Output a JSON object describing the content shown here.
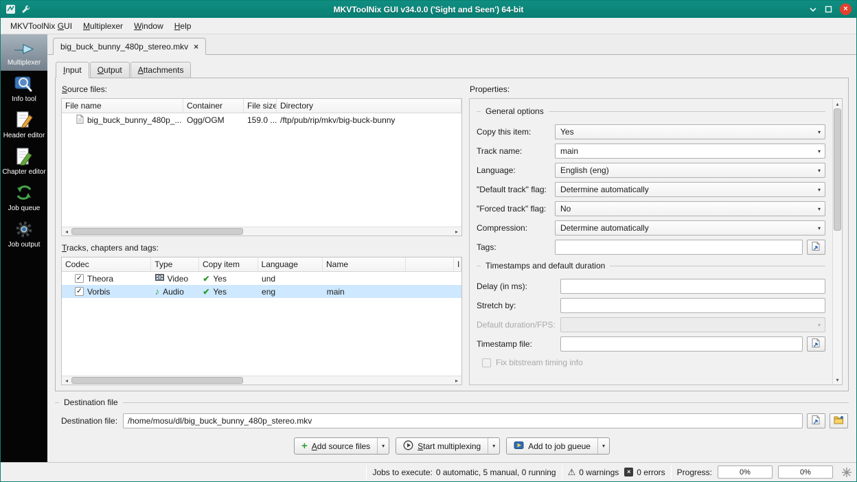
{
  "window": {
    "title": "MKVToolNix GUI v34.0.0 ('Sight and Seen') 64-bit"
  },
  "menubar": {
    "items": [
      {
        "label": "MKVToolNix GUI",
        "accel": 11
      },
      {
        "label": "Multiplexer",
        "accel": 0
      },
      {
        "label": "Window",
        "accel": 0
      },
      {
        "label": "Help",
        "accel": 0
      }
    ]
  },
  "sidebar": {
    "items": [
      {
        "label": "Multiplexer",
        "active": true
      },
      {
        "label": "Info tool",
        "active": false
      },
      {
        "label": "Header editor",
        "active": false
      },
      {
        "label": "Chapter editor",
        "active": false
      },
      {
        "label": "Job queue",
        "active": false
      },
      {
        "label": "Job output",
        "active": false
      }
    ]
  },
  "file_tab": {
    "label": "big_buck_bunny_480p_stereo.mkv"
  },
  "subtabs": [
    {
      "label": "Input",
      "accel": 0,
      "active": true
    },
    {
      "label": "Output",
      "accel": 0,
      "active": false
    },
    {
      "label": "Attachments",
      "accel": 0,
      "active": false
    }
  ],
  "source_files": {
    "label": {
      "label": "Source files:",
      "accel": 0
    },
    "columns": [
      "File name",
      "Container",
      "File size",
      "Directory"
    ],
    "rows": [
      {
        "file_name": "big_buck_bunny_480p_...",
        "container": "Ogg/OGM",
        "file_size": "159.0 ...",
        "directory": "/ftp/pub/rip/mkv/big-buck-bunny"
      }
    ]
  },
  "tracks": {
    "label": {
      "label": "Tracks, chapters and tags:",
      "accel": 0
    },
    "columns": [
      "Codec",
      "Type",
      "Copy item",
      "Language",
      "Name",
      "",
      "I"
    ],
    "rows": [
      {
        "codec": "Theora",
        "checked": true,
        "type": "Video",
        "copy_item": "Yes",
        "language": "und",
        "name": "",
        "selected": false
      },
      {
        "codec": "Vorbis",
        "checked": true,
        "type": "Audio",
        "copy_item": "Yes",
        "language": "eng",
        "name": "main",
        "selected": true
      }
    ]
  },
  "properties": {
    "label": "Properties:",
    "general": {
      "title": "General options",
      "copy_this_item": {
        "label": "Copy this item:",
        "value": "Yes"
      },
      "track_name": {
        "label": "Track name:",
        "value": "main"
      },
      "language": {
        "label": "Language:",
        "value": "English (eng)"
      },
      "default_track_flag": {
        "label": "\"Default track\" flag:",
        "value": "Determine automatically"
      },
      "forced_track_flag": {
        "label": "\"Forced track\" flag:",
        "value": "No"
      },
      "compression": {
        "label": "Compression:",
        "value": "Determine automatically"
      },
      "tags": {
        "label": "Tags:",
        "value": ""
      }
    },
    "timestamps": {
      "title": "Timestamps and default duration",
      "delay": {
        "label": "Delay (in ms):",
        "value": ""
      },
      "stretch_by": {
        "label": "Stretch by:",
        "value": ""
      },
      "default_duration": {
        "label": "Default duration/FPS:",
        "value": ""
      },
      "timestamp_file": {
        "label": "Timestamp file:",
        "value": ""
      },
      "fix_bitstream": {
        "label": "Fix bitstream timing info",
        "checked": false
      }
    }
  },
  "destination": {
    "group_title": "Destination file",
    "field_label": "Destination file:",
    "value": "/home/mosu/dl/big_buck_bunny_480p_stereo.mkv"
  },
  "actions": {
    "add_source_files": {
      "label": "Add source files",
      "accel": 0
    },
    "start_multiplexing": {
      "label": "Start multiplexing",
      "accel": 0
    },
    "add_to_job_queue": {
      "label": "Add to job queue",
      "accel": 11
    }
  },
  "statusbar": {
    "jobs_label": "Jobs to execute:",
    "jobs_value": "0 automatic, 5 manual, 0 running",
    "warnings": "0 warnings",
    "errors": "0 errors",
    "progress_label": "Progress:",
    "progress_left": "0%",
    "progress_right": "0%"
  },
  "icons": {
    "check": "✓",
    "copy_check": "✔",
    "music_note": "♪",
    "warning": "⚠",
    "error_x": "×",
    "close_x": "×",
    "combo_arrow": "▾",
    "scroll_left": "◂",
    "scroll_right": "▸",
    "scroll_up": "▴",
    "scroll_down": "▾",
    "plus": "+"
  },
  "colors": {
    "titlebar": "#0c8478",
    "selection": "#cde8ff",
    "sidebar_bg": "#050505",
    "accent_green": "#2b9c2b"
  }
}
